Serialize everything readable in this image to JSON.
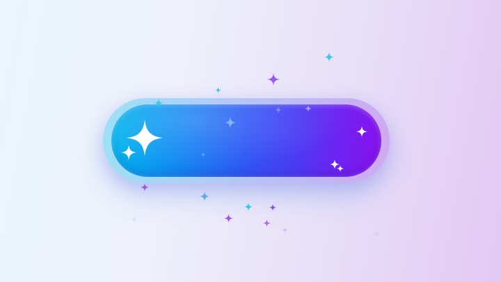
{
  "colors": {
    "button_gradient_start": "#00b7ee",
    "button_gradient_end": "#8a12ee",
    "sparkle_white": "#ffffff",
    "sparkle_cyan": "#38c7e6",
    "sparkle_purple": "#9b5be8",
    "sparkle_blue": "#5fa8e8"
  },
  "button": {
    "icon": "sparkles-icon"
  }
}
